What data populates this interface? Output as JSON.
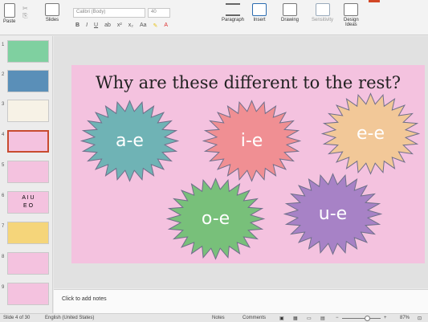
{
  "ribbon": {
    "paste": "Paste",
    "slides": "Slides",
    "font_name": "Calibri (Body)",
    "font_size": "40",
    "paragraph": "Paragraph",
    "insert": "Insert",
    "drawing": "Drawing",
    "sensitivity": "Sensitivity",
    "design_ideas_line1": "Design",
    "design_ideas_line2": "Ideas",
    "format_buttons": [
      "B",
      "I",
      "U",
      "ab",
      "x²",
      "x₂",
      "Aa"
    ]
  },
  "thumbnails": {
    "numbers": [
      "1",
      "2",
      "3",
      "4",
      "5",
      "6",
      "7",
      "8",
      "9"
    ],
    "slide6_letters": [
      "A I U",
      "E O"
    ]
  },
  "slide": {
    "title": "Why are these different to the rest?",
    "bursts": [
      {
        "label": "a-e",
        "color": "#6fb3b5"
      },
      {
        "label": "i-e",
        "color": "#f08f93"
      },
      {
        "label": "e-e",
        "color": "#f2c898"
      },
      {
        "label": "o-e",
        "color": "#78c07a"
      },
      {
        "label": "u-e",
        "color": "#a782c6"
      }
    ]
  },
  "notes": {
    "placeholder": "Click to add notes"
  },
  "status": {
    "slide_counter": "Slide 4 of 30",
    "language": "English (United States)",
    "notes": "Notes",
    "comments": "Comments",
    "zoom": "87%"
  },
  "colors": {
    "slide_bg": "#f4c2df",
    "active_border": "#c84b2f"
  }
}
